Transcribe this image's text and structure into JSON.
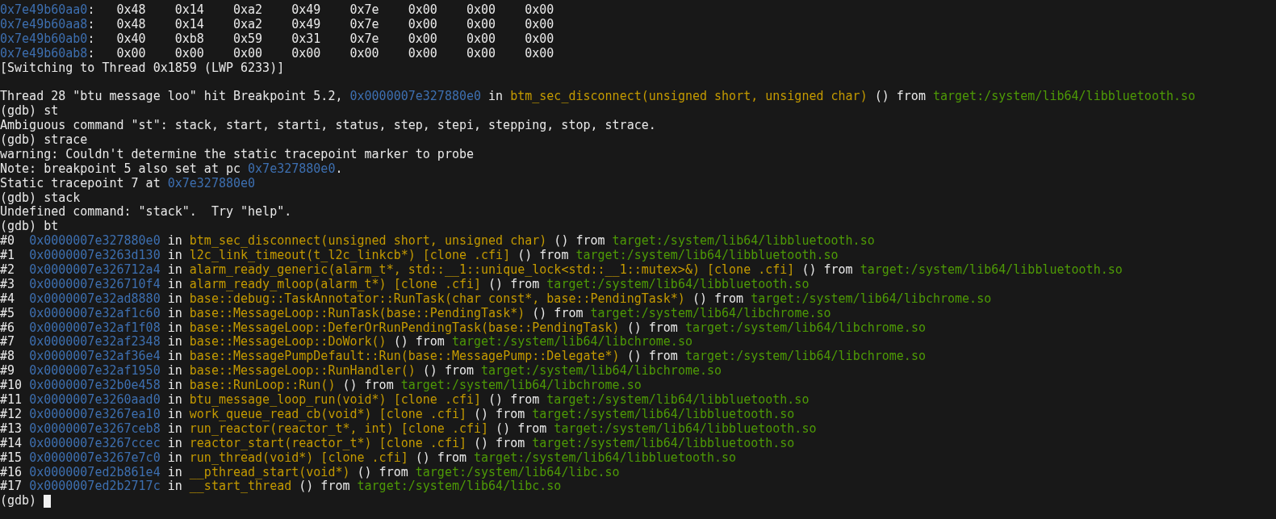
{
  "terminal": {
    "lines": [
      {
        "kind": "memory",
        "segments": [
          {
            "kind": "address",
            "text": "0x7e49b60aa0"
          },
          {
            "kind": "plain",
            "text": ":\t0x48\t0x14\t0xa2\t0x49\t0x7e\t0x00\t0x00\t0x00"
          }
        ]
      },
      {
        "kind": "memory",
        "segments": [
          {
            "kind": "address",
            "text": "0x7e49b60aa8"
          },
          {
            "kind": "plain",
            "text": ":\t0x48\t0x14\t0xa2\t0x49\t0x7e\t0x00\t0x00\t0x00"
          }
        ]
      },
      {
        "kind": "memory",
        "segments": [
          {
            "kind": "address",
            "text": "0x7e49b60ab0"
          },
          {
            "kind": "plain",
            "text": ":\t0x40\t0xb8\t0x59\t0x31\t0x7e\t0x00\t0x00\t0x00"
          }
        ]
      },
      {
        "kind": "memory",
        "segments": [
          {
            "kind": "address",
            "text": "0x7e49b60ab8"
          },
          {
            "kind": "plain",
            "text": ":\t0x00\t0x00\t0x00\t0x00\t0x00\t0x00\t0x00\t0x00"
          }
        ]
      },
      {
        "kind": "output",
        "segments": [
          {
            "kind": "plain",
            "text": "[Switching to Thread 0x1859 (LWP 6233)]"
          }
        ]
      },
      {
        "kind": "blank"
      },
      {
        "kind": "output",
        "segments": [
          {
            "kind": "plain",
            "text": "Thread 28 \"btu message loo\" hit Breakpoint 5.2, "
          },
          {
            "kind": "address",
            "text": "0x0000007e327880e0"
          },
          {
            "kind": "plain",
            "text": " in "
          },
          {
            "kind": "function",
            "text": "btm_sec_disconnect(unsigned short, unsigned char)"
          },
          {
            "kind": "plain",
            "text": " () from "
          },
          {
            "kind": "library",
            "text": "target:/system/lib64/libbluetooth.so"
          }
        ]
      },
      {
        "kind": "command",
        "segments": [
          {
            "kind": "plain",
            "text": "(gdb) st"
          }
        ]
      },
      {
        "kind": "output",
        "segments": [
          {
            "kind": "plain",
            "text": "Ambiguous command \"st\": stack, start, starti, status, step, stepi, stepping, stop, strace."
          }
        ]
      },
      {
        "kind": "command",
        "segments": [
          {
            "kind": "plain",
            "text": "(gdb) strace"
          }
        ]
      },
      {
        "kind": "output",
        "segments": [
          {
            "kind": "plain",
            "text": "warning: Couldn't determine the static tracepoint marker to probe"
          }
        ]
      },
      {
        "kind": "output",
        "segments": [
          {
            "kind": "plain",
            "text": "Note: breakpoint 5 also set at pc "
          },
          {
            "kind": "address",
            "text": "0x7e327880e0"
          },
          {
            "kind": "plain",
            "text": "."
          }
        ]
      },
      {
        "kind": "output",
        "segments": [
          {
            "kind": "plain",
            "text": "Static tracepoint 7 at "
          },
          {
            "kind": "address",
            "text": "0x7e327880e0"
          }
        ]
      },
      {
        "kind": "command",
        "segments": [
          {
            "kind": "plain",
            "text": "(gdb) stack"
          }
        ]
      },
      {
        "kind": "output",
        "segments": [
          {
            "kind": "plain",
            "text": "Undefined command: \"stack\".  Try \"help\"."
          }
        ]
      },
      {
        "kind": "command",
        "segments": [
          {
            "kind": "plain",
            "text": "(gdb) bt"
          }
        ]
      },
      {
        "kind": "frame",
        "segments": [
          {
            "kind": "plain",
            "text": "#0  "
          },
          {
            "kind": "address",
            "text": "0x0000007e327880e0"
          },
          {
            "kind": "plain",
            "text": " in "
          },
          {
            "kind": "function",
            "text": "btm_sec_disconnect(unsigned short, unsigned char)"
          },
          {
            "kind": "plain",
            "text": " () from "
          },
          {
            "kind": "library",
            "text": "target:/system/lib64/libbluetooth.so"
          }
        ]
      },
      {
        "kind": "frame",
        "segments": [
          {
            "kind": "plain",
            "text": "#1  "
          },
          {
            "kind": "address",
            "text": "0x0000007e3263d130"
          },
          {
            "kind": "plain",
            "text": " in "
          },
          {
            "kind": "function",
            "text": "l2c_link_timeout(t_l2c_linkcb*) [clone .cfi]"
          },
          {
            "kind": "plain",
            "text": " () from "
          },
          {
            "kind": "library",
            "text": "target:/system/lib64/libbluetooth.so"
          }
        ]
      },
      {
        "kind": "frame",
        "segments": [
          {
            "kind": "plain",
            "text": "#2  "
          },
          {
            "kind": "address",
            "text": "0x0000007e326712a4"
          },
          {
            "kind": "plain",
            "text": " in "
          },
          {
            "kind": "function",
            "text": "alarm_ready_generic(alarm_t*, std::__1::unique_lock<std::__1::mutex>&) [clone .cfi]"
          },
          {
            "kind": "plain",
            "text": " () from "
          },
          {
            "kind": "library",
            "text": "target:/system/lib64/libbluetooth.so"
          }
        ]
      },
      {
        "kind": "frame",
        "segments": [
          {
            "kind": "plain",
            "text": "#3  "
          },
          {
            "kind": "address",
            "text": "0x0000007e326710f4"
          },
          {
            "kind": "plain",
            "text": " in "
          },
          {
            "kind": "function",
            "text": "alarm_ready_mloop(alarm_t*) [clone .cfi]"
          },
          {
            "kind": "plain",
            "text": " () from "
          },
          {
            "kind": "library",
            "text": "target:/system/lib64/libbluetooth.so"
          }
        ]
      },
      {
        "kind": "frame",
        "segments": [
          {
            "kind": "plain",
            "text": "#4  "
          },
          {
            "kind": "address",
            "text": "0x0000007e32ad8880"
          },
          {
            "kind": "plain",
            "text": " in "
          },
          {
            "kind": "function",
            "text": "base::debug::TaskAnnotator::RunTask(char const*, base::PendingTask*)"
          },
          {
            "kind": "plain",
            "text": " () from "
          },
          {
            "kind": "library",
            "text": "target:/system/lib64/libchrome.so"
          }
        ]
      },
      {
        "kind": "frame",
        "segments": [
          {
            "kind": "plain",
            "text": "#5  "
          },
          {
            "kind": "address",
            "text": "0x0000007e32af1c60"
          },
          {
            "kind": "plain",
            "text": " in "
          },
          {
            "kind": "function",
            "text": "base::MessageLoop::RunTask(base::PendingTask*)"
          },
          {
            "kind": "plain",
            "text": " () from "
          },
          {
            "kind": "library",
            "text": "target:/system/lib64/libchrome.so"
          }
        ]
      },
      {
        "kind": "frame",
        "segments": [
          {
            "kind": "plain",
            "text": "#6  "
          },
          {
            "kind": "address",
            "text": "0x0000007e32af1f08"
          },
          {
            "kind": "plain",
            "text": " in "
          },
          {
            "kind": "function",
            "text": "base::MessageLoop::DeferOrRunPendingTask(base::PendingTask)"
          },
          {
            "kind": "plain",
            "text": " () from "
          },
          {
            "kind": "library",
            "text": "target:/system/lib64/libchrome.so"
          }
        ]
      },
      {
        "kind": "frame",
        "segments": [
          {
            "kind": "plain",
            "text": "#7  "
          },
          {
            "kind": "address",
            "text": "0x0000007e32af2348"
          },
          {
            "kind": "plain",
            "text": " in "
          },
          {
            "kind": "function",
            "text": "base::MessageLoop::DoWork()"
          },
          {
            "kind": "plain",
            "text": " () from "
          },
          {
            "kind": "library",
            "text": "target:/system/lib64/libchrome.so"
          }
        ]
      },
      {
        "kind": "frame",
        "segments": [
          {
            "kind": "plain",
            "text": "#8  "
          },
          {
            "kind": "address",
            "text": "0x0000007e32af36e4"
          },
          {
            "kind": "plain",
            "text": " in "
          },
          {
            "kind": "function",
            "text": "base::MessagePumpDefault::Run(base::MessagePump::Delegate*)"
          },
          {
            "kind": "plain",
            "text": " () from "
          },
          {
            "kind": "library",
            "text": "target:/system/lib64/libchrome.so"
          }
        ]
      },
      {
        "kind": "frame",
        "segments": [
          {
            "kind": "plain",
            "text": "#9  "
          },
          {
            "kind": "address",
            "text": "0x0000007e32af1950"
          },
          {
            "kind": "plain",
            "text": " in "
          },
          {
            "kind": "function",
            "text": "base::MessageLoop::RunHandler()"
          },
          {
            "kind": "plain",
            "text": " () from "
          },
          {
            "kind": "library",
            "text": "target:/system/lib64/libchrome.so"
          }
        ]
      },
      {
        "kind": "frame",
        "segments": [
          {
            "kind": "plain",
            "text": "#10 "
          },
          {
            "kind": "address",
            "text": "0x0000007e32b0e458"
          },
          {
            "kind": "plain",
            "text": " in "
          },
          {
            "kind": "function",
            "text": "base::RunLoop::Run()"
          },
          {
            "kind": "plain",
            "text": " () from "
          },
          {
            "kind": "library",
            "text": "target:/system/lib64/libchrome.so"
          }
        ]
      },
      {
        "kind": "frame",
        "segments": [
          {
            "kind": "plain",
            "text": "#11 "
          },
          {
            "kind": "address",
            "text": "0x0000007e3260aad0"
          },
          {
            "kind": "plain",
            "text": " in "
          },
          {
            "kind": "function",
            "text": "btu_message_loop_run(void*) [clone .cfi]"
          },
          {
            "kind": "plain",
            "text": " () from "
          },
          {
            "kind": "library",
            "text": "target:/system/lib64/libbluetooth.so"
          }
        ]
      },
      {
        "kind": "frame",
        "segments": [
          {
            "kind": "plain",
            "text": "#12 "
          },
          {
            "kind": "address",
            "text": "0x0000007e3267ea10"
          },
          {
            "kind": "plain",
            "text": " in "
          },
          {
            "kind": "function",
            "text": "work_queue_read_cb(void*) [clone .cfi]"
          },
          {
            "kind": "plain",
            "text": " () from "
          },
          {
            "kind": "library",
            "text": "target:/system/lib64/libbluetooth.so"
          }
        ]
      },
      {
        "kind": "frame",
        "segments": [
          {
            "kind": "plain",
            "text": "#13 "
          },
          {
            "kind": "address",
            "text": "0x0000007e3267ceb8"
          },
          {
            "kind": "plain",
            "text": " in "
          },
          {
            "kind": "function",
            "text": "run_reactor(reactor_t*, int) [clone .cfi]"
          },
          {
            "kind": "plain",
            "text": " () from "
          },
          {
            "kind": "library",
            "text": "target:/system/lib64/libbluetooth.so"
          }
        ]
      },
      {
        "kind": "frame",
        "segments": [
          {
            "kind": "plain",
            "text": "#14 "
          },
          {
            "kind": "address",
            "text": "0x0000007e3267ccec"
          },
          {
            "kind": "plain",
            "text": " in "
          },
          {
            "kind": "function",
            "text": "reactor_start(reactor_t*) [clone .cfi]"
          },
          {
            "kind": "plain",
            "text": " () from "
          },
          {
            "kind": "library",
            "text": "target:/system/lib64/libbluetooth.so"
          }
        ]
      },
      {
        "kind": "frame",
        "segments": [
          {
            "kind": "plain",
            "text": "#15 "
          },
          {
            "kind": "address",
            "text": "0x0000007e3267e7c0"
          },
          {
            "kind": "plain",
            "text": " in "
          },
          {
            "kind": "function",
            "text": "run_thread(void*) [clone .cfi]"
          },
          {
            "kind": "plain",
            "text": " () from "
          },
          {
            "kind": "library",
            "text": "target:/system/lib64/libbluetooth.so"
          }
        ]
      },
      {
        "kind": "frame",
        "segments": [
          {
            "kind": "plain",
            "text": "#16 "
          },
          {
            "kind": "address",
            "text": "0x0000007ed2b861e4"
          },
          {
            "kind": "plain",
            "text": " in "
          },
          {
            "kind": "function",
            "text": "__pthread_start(void*)"
          },
          {
            "kind": "plain",
            "text": " () from "
          },
          {
            "kind": "library",
            "text": "target:/system/lib64/libc.so"
          }
        ]
      },
      {
        "kind": "frame",
        "segments": [
          {
            "kind": "plain",
            "text": "#17 "
          },
          {
            "kind": "address",
            "text": "0x0000007ed2b2717c"
          },
          {
            "kind": "plain",
            "text": " in "
          },
          {
            "kind": "function",
            "text": "__start_thread"
          },
          {
            "kind": "plain",
            "text": " () from "
          },
          {
            "kind": "library",
            "text": "target:/system/lib64/libc.so"
          }
        ]
      },
      {
        "kind": "prompt",
        "segments": [
          {
            "kind": "plain",
            "text": "(gdb)"
          }
        ]
      }
    ]
  }
}
